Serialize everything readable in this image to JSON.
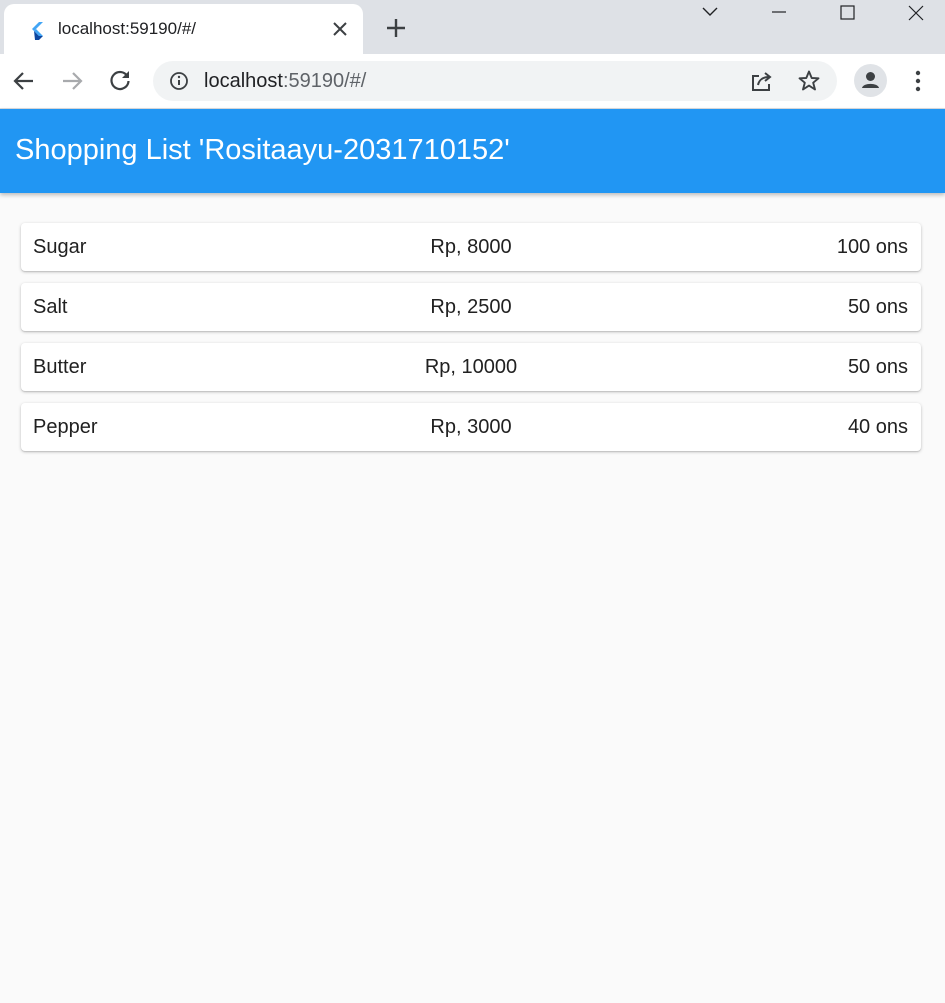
{
  "browser": {
    "tab_title": "localhost:59190/#/",
    "favicon": "flutter-logo-icon",
    "url_host": "localhost",
    "url_path": ":59190/#/",
    "icons": {
      "close_tab": "close-icon",
      "new_tab": "plus-icon",
      "back": "arrow-left-icon",
      "forward": "arrow-right-icon",
      "reload": "reload-icon",
      "site_info": "info-icon",
      "share": "share-icon",
      "bookmark": "star-icon",
      "profile": "avatar-icon",
      "menu": "kebab-menu-icon",
      "tab_search": "chevron-down-icon",
      "minimize": "minimize-icon",
      "maximize": "maximize-icon",
      "close_window": "close-icon"
    }
  },
  "app": {
    "title": "Shopping List 'Rositaayu-2031710152'",
    "colors": {
      "appbar": "#2196f3",
      "background": "#fafafa",
      "card": "#ffffff"
    },
    "items": [
      {
        "name": "Sugar",
        "price": "Rp, 8000",
        "qty": "100 ons"
      },
      {
        "name": "Salt",
        "price": "Rp, 2500",
        "qty": "50 ons"
      },
      {
        "name": "Butter",
        "price": "Rp, 10000",
        "qty": "50 ons"
      },
      {
        "name": "Pepper",
        "price": "Rp, 3000",
        "qty": "40 ons"
      }
    ]
  }
}
